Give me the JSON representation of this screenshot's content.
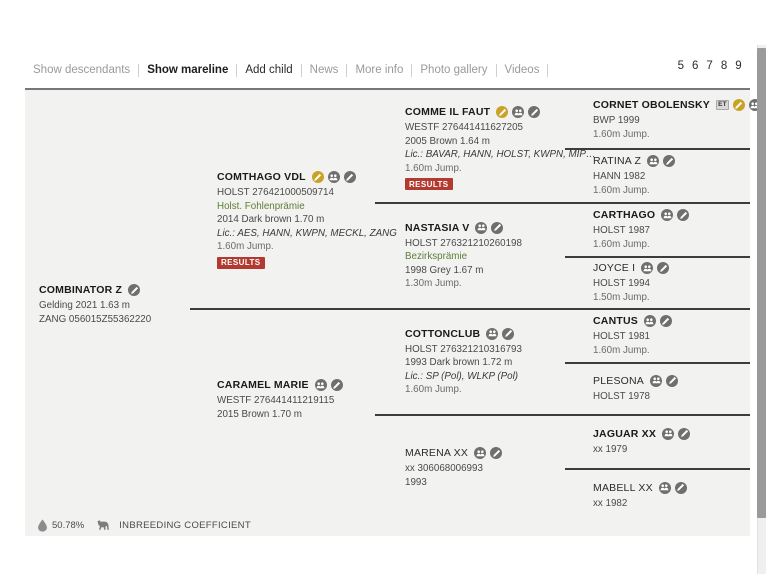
{
  "nav": {
    "items": [
      {
        "label": "Show descendants",
        "style": "muted"
      },
      {
        "label": "Show mareline",
        "style": "bold"
      },
      {
        "label": "Add child",
        "style": "dark"
      },
      {
        "label": "News",
        "style": "muted"
      },
      {
        "label": "More info",
        "style": "muted"
      },
      {
        "label": "Photo gallery",
        "style": "muted"
      },
      {
        "label": "Videos",
        "style": "muted"
      }
    ],
    "generation_numbers": "5 6 7 8 9"
  },
  "pedigree": {
    "subject": {
      "name": "COMBINATOR Z",
      "icons": [
        "pencil-gray"
      ],
      "lines": [
        "Gelding 2021 1.63 m",
        "ZANG 056015Z55362220"
      ]
    },
    "gen2": [
      {
        "name": "COMTHAGO VDL",
        "icons": [
          "pencil-gold",
          "family",
          "pencil-gray"
        ],
        "lines": [
          {
            "text": "HOLST 276421000509714",
            "style": "plain"
          },
          {
            "text": "Holst. Fohlenprämie",
            "style": "green"
          },
          {
            "text": "2014 Dark brown 1.70 m",
            "style": "plain"
          },
          {
            "text": "Lic.: AES, HANN, KWPN, MECKL, ZANG",
            "style": "ital"
          },
          {
            "text": "1.60m Jump.",
            "style": "jump"
          }
        ],
        "results": "RESULTS"
      },
      {
        "name": "CARAMEL MARIE",
        "icons": [
          "family",
          "pencil-gray"
        ],
        "lines": [
          {
            "text": "WESTF 276441411219115",
            "style": "plain"
          },
          {
            "text": "2015 Brown 1.70 m",
            "style": "plain"
          }
        ],
        "results": null
      }
    ],
    "gen3": [
      {
        "name": "COMME IL FAUT",
        "icons": [
          "pencil-gold",
          "family",
          "pencil-gray"
        ],
        "lines": [
          {
            "text": "WESTF 276441411627205",
            "style": "plain"
          },
          {
            "text": "2005 Brown 1.64 m",
            "style": "plain"
          },
          {
            "text": "Lic.: BAVAR, HANN, HOLST, KWPN, MIP…",
            "style": "ital"
          },
          {
            "text": "1.60m Jump.",
            "style": "jump"
          }
        ],
        "results": "RESULTS"
      },
      {
        "name": "NASTASIA V",
        "icons": [
          "family",
          "pencil-gray"
        ],
        "lines": [
          {
            "text": "HOLST 276321210260198",
            "style": "plain"
          },
          {
            "text": "Bezirksprämie",
            "style": "green"
          },
          {
            "text": "1998 Grey 1.67 m",
            "style": "plain"
          },
          {
            "text": "1.30m Jump.",
            "style": "jump"
          }
        ],
        "results": null
      },
      {
        "name": "COTTONCLUB",
        "icons": [
          "family",
          "pencil-gray"
        ],
        "lines": [
          {
            "text": "HOLST 276321210316793",
            "style": "plain"
          },
          {
            "text": "1993 Dark brown 1.72 m",
            "style": "plain"
          },
          {
            "text": "Lic.: SP (Pol), WLKP (Pol)",
            "style": "ital"
          },
          {
            "text": "1.60m Jump.",
            "style": "jump"
          }
        ],
        "results": null
      },
      {
        "name": "MARENA XX",
        "icons": [
          "family",
          "pencil-gray"
        ],
        "bold": false,
        "lines": [
          {
            "text": "xx 306068006993",
            "style": "plain"
          },
          {
            "text": "1993",
            "style": "plain"
          }
        ],
        "results": null
      }
    ],
    "gen4": [
      {
        "name": "CORNET OBOLENSKY",
        "badge": "ET",
        "icons": [
          "pencil-gold",
          "family",
          "pencil-gray"
        ],
        "lines": [
          {
            "text": "BWP 1999",
            "style": "plain"
          },
          {
            "text": "1.60m Jump.",
            "style": "jump"
          }
        ]
      },
      {
        "name": "RATINA Z",
        "badge": null,
        "bold": false,
        "icons": [
          "family",
          "pencil-gray"
        ],
        "lines": [
          {
            "text": "HANN 1982",
            "style": "plain"
          },
          {
            "text": "1.60m Jump.",
            "style": "jump"
          }
        ]
      },
      {
        "name": "CARTHAGO",
        "badge": null,
        "icons": [
          "family",
          "pencil-gray"
        ],
        "lines": [
          {
            "text": "HOLST 1987",
            "style": "plain"
          },
          {
            "text": "1.60m Jump.",
            "style": "jump"
          }
        ]
      },
      {
        "name": "JOYCE I",
        "badge": null,
        "bold": false,
        "icons": [
          "family",
          "pencil-gray"
        ],
        "lines": [
          {
            "text": "HOLST 1994",
            "style": "plain"
          },
          {
            "text": "1.50m Jump.",
            "style": "jump"
          }
        ]
      },
      {
        "name": "CANTUS",
        "badge": null,
        "icons": [
          "family",
          "pencil-gray"
        ],
        "lines": [
          {
            "text": "HOLST 1981",
            "style": "plain"
          },
          {
            "text": "1.60m Jump.",
            "style": "jump"
          }
        ]
      },
      {
        "name": "PLESONA",
        "badge": null,
        "bold": false,
        "icons": [
          "family",
          "pencil-gray"
        ],
        "lines": [
          {
            "text": "HOLST 1978",
            "style": "plain"
          }
        ]
      },
      {
        "name": "JAGUAR XX",
        "badge": null,
        "icons": [
          "family",
          "pencil-gray"
        ],
        "lines": [
          {
            "text": "xx 1979",
            "style": "plain"
          }
        ]
      },
      {
        "name": "MABELL XX",
        "badge": null,
        "bold": false,
        "icons": [
          "family",
          "pencil-gray"
        ],
        "lines": [
          {
            "text": "xx 1982",
            "style": "plain"
          }
        ]
      }
    ]
  },
  "footer": {
    "percent": "50.78%",
    "label": "INBREEDING COEFFICIENT"
  }
}
